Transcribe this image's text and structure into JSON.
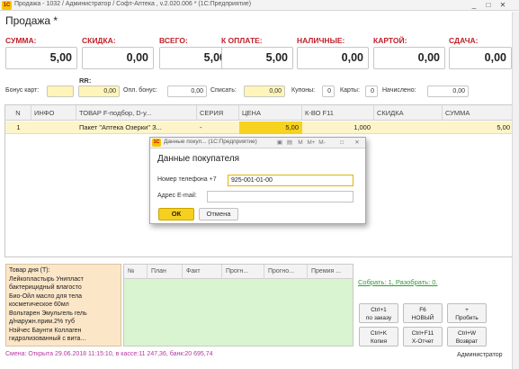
{
  "window": {
    "title": "Продажа - 1032 / Администратор / Софт-Аптека , v.2.020.006 *  (1С:Предприятие)",
    "logo": "1С",
    "controls": [
      "_",
      "□",
      "✕"
    ]
  },
  "form_title": "Продажа *",
  "totals": [
    {
      "label": "СУММА:",
      "value": "5,00"
    },
    {
      "label": "СКИДКА:",
      "value": "0,00"
    },
    {
      "label": "ВСЕГО:",
      "value": "5,00"
    },
    {
      "label": "К ОПЛАТЕ:",
      "value": "5,00"
    },
    {
      "label": "НАЛИЧНЫЕ:",
      "value": "0,00"
    },
    {
      "label": "КАРТОЙ:",
      "value": "0,00"
    },
    {
      "label": "СДАЧА:",
      "value": "0,00"
    }
  ],
  "rr_label": "RR:",
  "fields": {
    "bonus_card_label": "Бонус карт:",
    "bonus_card_value": "",
    "rr_value": "0,00",
    "opl_bonus_label": "Опл. бонус:",
    "opl_bonus_value": "0,00",
    "spisat_label": "Списать:",
    "spisat_value": "0,00",
    "kupony_label": "Купоны:",
    "kupony_value": "0",
    "karty_label": "Карты:",
    "karty_value": "0",
    "nachisleno_label": "Начислено:",
    "nachisleno_value": "0,00"
  },
  "grid": {
    "columns": [
      "N",
      "ИНФО",
      "ТОВАР  F-подбор, D-у...",
      "СЕРИЯ",
      "ЦЕНА",
      "К-ВО F11",
      "СКИДКА",
      "СУММА"
    ],
    "rows": [
      {
        "n": "1",
        "info": "",
        "product": "Пакет \"Аптека Озерки\" З...",
        "series": "-",
        "price": "5,00",
        "qty": "1,000",
        "discount": "",
        "sum": "5,00"
      }
    ]
  },
  "dialog": {
    "title": "Данные покуп... (1С:Предприятие)",
    "title_controls": [
      "▣",
      "▤",
      "M",
      "M+",
      "M-",
      "□",
      "✕"
    ],
    "heading": "Данные покупателя",
    "phone_label": "Номер телефона +7",
    "phone_value": "925-001-01-00",
    "email_label": "Адрес E-mail:",
    "email_value": "",
    "ok_label": "ОК",
    "cancel_label": "Отмена"
  },
  "product_of_day": {
    "lines": [
      "Товар дня (Т):",
      "Лейкопластырь Унипласт",
      "бактерицидный влагосто",
      "Био-Ойл масло для тела",
      "косметическое 60мл",
      "Вольтарен Эмульгель гель",
      "д/наружн.прим.2% туб",
      "Нэйчес Баунти Коллаген",
      "гидролизованный с вита..."
    ]
  },
  "order_grid": {
    "columns": [
      "№",
      "План",
      "Факт",
      "Прогн...",
      "Прогно...",
      "Премия ..."
    ]
  },
  "collected_link": "Собрать: 1, Разобрать: 0.",
  "function_buttons": [
    {
      "line1": "Ctrl+1",
      "line2": "по заказу"
    },
    {
      "line1": "F6",
      "line2": "НОВЫЙ"
    },
    {
      "line1": "+",
      "line2": "Пробить"
    },
    {
      "line1": "Ctrl+K",
      "line2": "Копия"
    },
    {
      "line1": "Ctrl+F11",
      "line2": "X-Отчет"
    },
    {
      "line1": "Ctrl+W",
      "line2": "Возврат"
    }
  ],
  "status": "Смена: Открыта 29.06.2018 11:15:10, в кассе:11 247,36, банк:20 695,74",
  "user": "Администратор"
}
